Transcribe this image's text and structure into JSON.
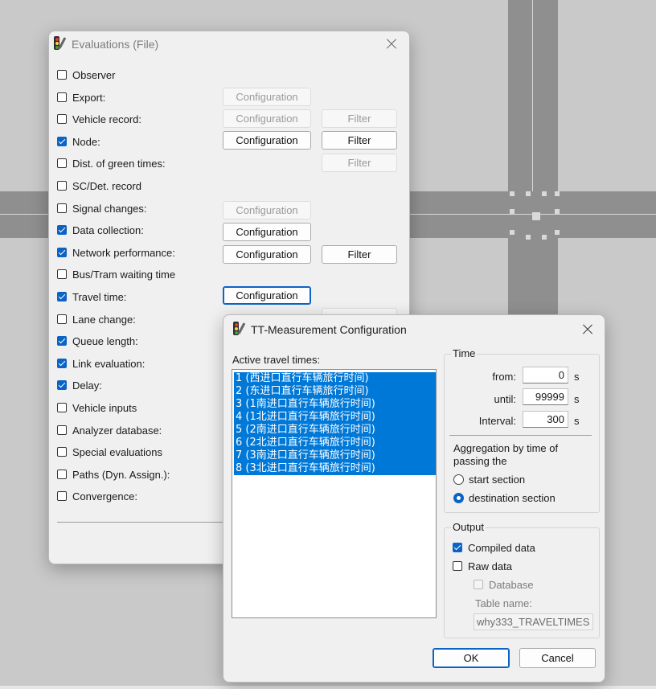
{
  "colors": {
    "accent": "#0b63c5",
    "selection": "#0078d7",
    "road": "#8f8f8f",
    "canvas": "#c9c9c9"
  },
  "evaluations_dialog": {
    "title": "Evaluations (File)",
    "icon": "traffic-light-wrench-icon",
    "items": [
      {
        "label": "Observer",
        "checked": false
      },
      {
        "label": "Export:",
        "checked": false
      },
      {
        "label": "Vehicle record:",
        "checked": false
      },
      {
        "label": "Node:",
        "checked": true
      },
      {
        "label": "Dist. of green times:",
        "checked": false
      },
      {
        "label": "SC/Det. record",
        "checked": false
      },
      {
        "label": "Signal changes:",
        "checked": false
      },
      {
        "label": "Data collection:",
        "checked": true
      },
      {
        "label": "Network performance:",
        "checked": true
      },
      {
        "label": "Bus/Tram waiting time",
        "checked": false
      },
      {
        "label": "Travel time:",
        "checked": true
      },
      {
        "label": "Lane change:",
        "checked": false
      },
      {
        "label": "Queue length:",
        "checked": true
      },
      {
        "label": "Link evaluation:",
        "checked": true
      },
      {
        "label": "Delay:",
        "checked": true
      },
      {
        "label": "Vehicle inputs",
        "checked": false
      },
      {
        "label": "Analyzer database:",
        "checked": false
      },
      {
        "label": "Special evaluations",
        "checked": false
      },
      {
        "label": "Paths (Dyn. Assign.):",
        "checked": false
      },
      {
        "label": "Convergence:",
        "checked": false
      }
    ],
    "configuration_label": "Configuration",
    "filter_label": "Filter"
  },
  "tt_dialog": {
    "title": "TT-Measurement Configuration",
    "active_label": "Active travel times:",
    "travel_times": [
      "1 (西进口直行车辆旅行时间)",
      "2 (东进口直行车辆旅行时间)",
      "3 (1南进口直行车辆旅行时间)",
      "4 (1北进口直行车辆旅行时间)",
      "5 (2南进口直行车辆旅行时间)",
      "6 (2北进口直行车辆旅行时间)",
      "7 (3南进口直行车辆旅行时间)",
      "8 (3北进口直行车辆旅行时间)"
    ],
    "time": {
      "group_title": "Time",
      "from_label": "from:",
      "from_value": "0",
      "until_label": "until:",
      "until_value": "99999",
      "interval_label": "Interval:",
      "interval_value": "300",
      "unit": "s"
    },
    "aggregation": {
      "label": "Aggregation by time of passing the",
      "options": [
        "start section",
        "destination section"
      ],
      "selected": "destination section"
    },
    "output": {
      "group_title": "Output",
      "compiled_label": "Compiled data",
      "compiled_checked": true,
      "raw_label": "Raw data",
      "raw_checked": false,
      "database_label": "Database",
      "database_checked": false,
      "table_name_label": "Table name:",
      "table_name_value": "why333_TRAVELTIMES"
    },
    "ok_label": "OK",
    "cancel_label": "Cancel"
  }
}
